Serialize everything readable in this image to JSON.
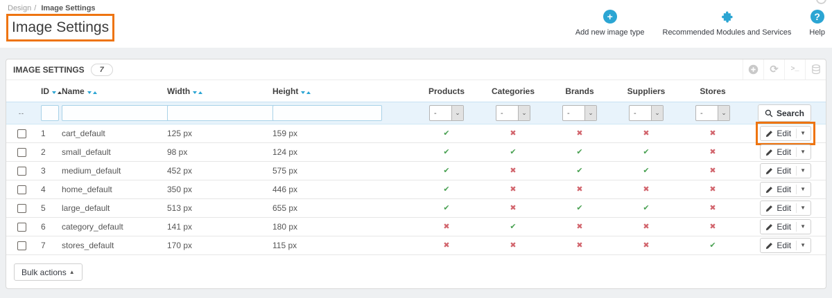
{
  "colors": {
    "accent_orange": "#ee7410",
    "icon_blue": "#2ba5d3",
    "check_green": "#49a152",
    "cross_red": "#d2656d"
  },
  "breadcrumb": {
    "parent": "Design",
    "separator": "/",
    "current": "Image Settings"
  },
  "page_title": "Image Settings",
  "header_actions": {
    "add_new": "Add new image type",
    "modules": "Recommended Modules and Services",
    "help": "Help"
  },
  "panel": {
    "title": "IMAGE SETTINGS",
    "count": "7"
  },
  "table": {
    "columns": {
      "id": "ID",
      "name": "Name",
      "width": "Width",
      "height": "Height",
      "bool": [
        "Products",
        "Categories",
        "Brands",
        "Suppliers",
        "Stores"
      ]
    },
    "filter": {
      "dash": "--",
      "select_value": "-",
      "search_label": "Search"
    },
    "check_glyph": "✔",
    "cross_glyph": "✖",
    "edit_label": "Edit",
    "rows": [
      {
        "id": "1",
        "name": "cart_default",
        "width": "125 px",
        "height": "159 px",
        "flags": [
          true,
          false,
          false,
          false,
          false
        ],
        "highlighted": true
      },
      {
        "id": "2",
        "name": "small_default",
        "width": "98 px",
        "height": "124 px",
        "flags": [
          true,
          true,
          true,
          true,
          false
        ],
        "highlighted": false
      },
      {
        "id": "3",
        "name": "medium_default",
        "width": "452 px",
        "height": "575 px",
        "flags": [
          true,
          false,
          true,
          true,
          false
        ],
        "highlighted": false
      },
      {
        "id": "4",
        "name": "home_default",
        "width": "350 px",
        "height": "446 px",
        "flags": [
          true,
          false,
          false,
          false,
          false
        ],
        "highlighted": false
      },
      {
        "id": "5",
        "name": "large_default",
        "width": "513 px",
        "height": "655 px",
        "flags": [
          true,
          false,
          true,
          true,
          false
        ],
        "highlighted": false
      },
      {
        "id": "6",
        "name": "category_default",
        "width": "141 px",
        "height": "180 px",
        "flags": [
          false,
          true,
          false,
          false,
          false
        ],
        "highlighted": false
      },
      {
        "id": "7",
        "name": "stores_default",
        "width": "170 px",
        "height": "115 px",
        "flags": [
          false,
          false,
          false,
          false,
          true
        ],
        "highlighted": false
      }
    ]
  },
  "bulk_actions": {
    "label": "Bulk actions"
  }
}
